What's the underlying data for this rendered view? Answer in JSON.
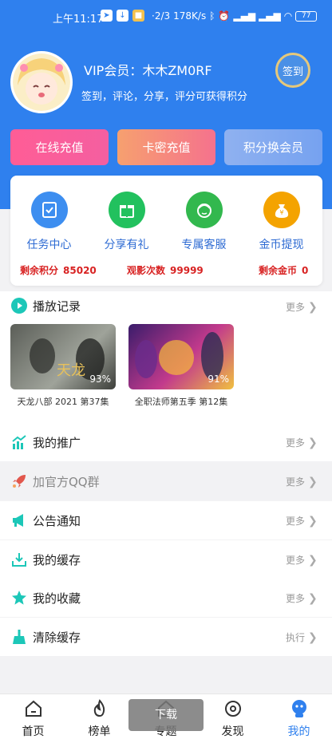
{
  "status_bar": {
    "time": "上午11:17",
    "page_indicator": "·2/3",
    "network_speed": "178K/s",
    "battery": "77"
  },
  "profile": {
    "name": "VIP会员：木木ZM0RF",
    "desc": "签到，评论，分享，评分可获得积分",
    "checkin_label": "签到"
  },
  "actions": {
    "recharge": "在线充值",
    "card": "卡密充值",
    "points": "积分换会员"
  },
  "functions": [
    {
      "label": "任务中心",
      "color": "#3d8ef0",
      "icon": "task-icon"
    },
    {
      "label": "分享有礼",
      "color": "#22c15e",
      "icon": "gift-icon"
    },
    {
      "label": "专属客服",
      "color": "#32b84e",
      "icon": "service-icon"
    },
    {
      "label": "金币提现",
      "color": "#f4a300",
      "icon": "money-bag-icon"
    }
  ],
  "stats": {
    "points_label": "剩余积分",
    "points_value": "85020",
    "views_label": "观影次数",
    "views_value": "99999",
    "coins_label": "剩余金币",
    "coins_value": "0"
  },
  "history": {
    "title": "播放记录",
    "more": "更多",
    "items": [
      {
        "title": "天龙八部 2021 第37集",
        "progress": "93%"
      },
      {
        "title": "全职法师第五季 第12集",
        "progress": "91%"
      }
    ]
  },
  "list": [
    {
      "label": "我的推广",
      "more": "更多"
    },
    {
      "label": "加官方QQ群",
      "more": "更多"
    },
    {
      "label": "公告通知",
      "more": "更多"
    },
    {
      "label": "我的缓存",
      "more": "更多"
    },
    {
      "label": "我的收藏",
      "more": "更多"
    },
    {
      "label": "清除缓存",
      "more": "执行"
    }
  ],
  "nav": {
    "home": "首页",
    "ranking": "榜单",
    "topics": "专题",
    "discover": "发现",
    "mine": "我的"
  },
  "toast": "下载",
  "colors": {
    "brand": "#2f80ee",
    "stat_red": "#d82222"
  }
}
